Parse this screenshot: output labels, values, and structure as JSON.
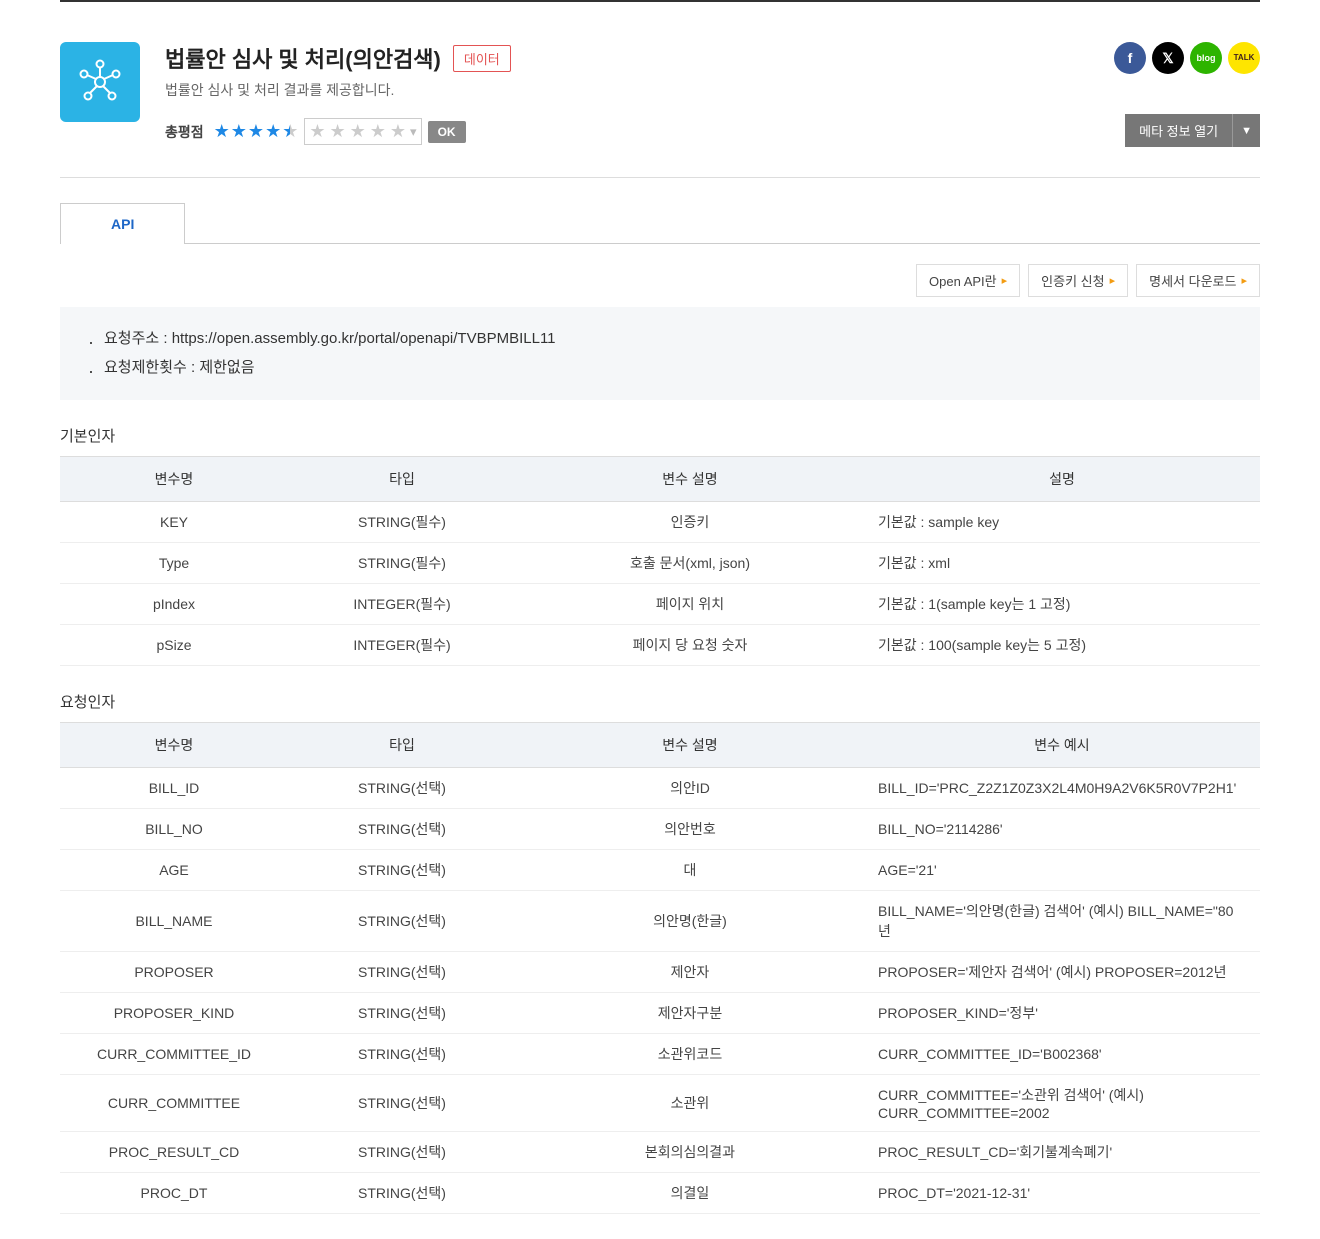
{
  "header": {
    "title": "법률안 심사 및 처리(의안검색)",
    "badge": "데이터",
    "subtitle": "법률안 심사 및 처리 결과를 제공합니다.",
    "ratingLabel": "총평점",
    "okLabel": "OK",
    "metaBtn": "메타 정보 열기"
  },
  "social": {
    "fb": "f",
    "x": "𝕏",
    "blog": "blog",
    "kakao": "TALK"
  },
  "tab": {
    "api": "API"
  },
  "actions": {
    "openApi": "Open API란",
    "authKey": "인증키 신청",
    "spec": "명세서 다운로드"
  },
  "info": {
    "requestUrlLabel": "요청주소 : ",
    "requestUrl": "https://open.assembly.go.kr/portal/openapi/TVBPMBILL11",
    "limitLabel": "요청제한횟수 : ",
    "limit": "제한없음"
  },
  "basicParams": {
    "title": "기본인자",
    "headers": [
      "변수명",
      "타입",
      "변수 설명",
      "설명"
    ],
    "rows": [
      {
        "name": "KEY",
        "type": "STRING(필수)",
        "desc": "인증키",
        "note": "기본값 : sample key"
      },
      {
        "name": "Type",
        "type": "STRING(필수)",
        "desc": "호출 문서(xml, json)",
        "note": "기본값 : xml"
      },
      {
        "name": "pIndex",
        "type": "INTEGER(필수)",
        "desc": "페이지 위치",
        "note": "기본값 : 1(sample key는 1 고정)"
      },
      {
        "name": "pSize",
        "type": "INTEGER(필수)",
        "desc": "페이지 당 요청 숫자",
        "note": "기본값 : 100(sample key는 5 고정)"
      }
    ]
  },
  "reqParams": {
    "title": "요청인자",
    "headers": [
      "변수명",
      "타입",
      "변수 설명",
      "변수 예시"
    ],
    "rows": [
      {
        "name": "BILL_ID",
        "type": "STRING(선택)",
        "desc": "의안ID",
        "note": "BILL_ID='PRC_Z2Z1Z0Z3X2L4M0H9A2V6K5R0V7P2H1'"
      },
      {
        "name": "BILL_NO",
        "type": "STRING(선택)",
        "desc": "의안번호",
        "note": "BILL_NO='2114286'"
      },
      {
        "name": "AGE",
        "type": "STRING(선택)",
        "desc": "대",
        "note": "AGE='21'"
      },
      {
        "name": "BILL_NAME",
        "type": "STRING(선택)",
        "desc": "의안명(한글)",
        "note": "BILL_NAME='의안명(한글) 검색어' (예시) BILL_NAME=\"80년"
      },
      {
        "name": "PROPOSER",
        "type": "STRING(선택)",
        "desc": "제안자",
        "note": "PROPOSER='제안자 검색어' (예시) PROPOSER=2012년"
      },
      {
        "name": "PROPOSER_KIND",
        "type": "STRING(선택)",
        "desc": "제안자구분",
        "note": "PROPOSER_KIND='정부'"
      },
      {
        "name": "CURR_COMMITTEE_ID",
        "type": "STRING(선택)",
        "desc": "소관위코드",
        "note": "CURR_COMMITTEE_ID='B002368'"
      },
      {
        "name": "CURR_COMMITTEE",
        "type": "STRING(선택)",
        "desc": "소관위",
        "note": "CURR_COMMITTEE='소관위 검색어' (예시) CURR_COMMITTEE=2002"
      },
      {
        "name": "PROC_RESULT_CD",
        "type": "STRING(선택)",
        "desc": "본회의심의결과",
        "note": "PROC_RESULT_CD='회기불계속폐기'"
      },
      {
        "name": "PROC_DT",
        "type": "STRING(선택)",
        "desc": "의결일",
        "note": "PROC_DT='2021-12-31'"
      }
    ]
  }
}
